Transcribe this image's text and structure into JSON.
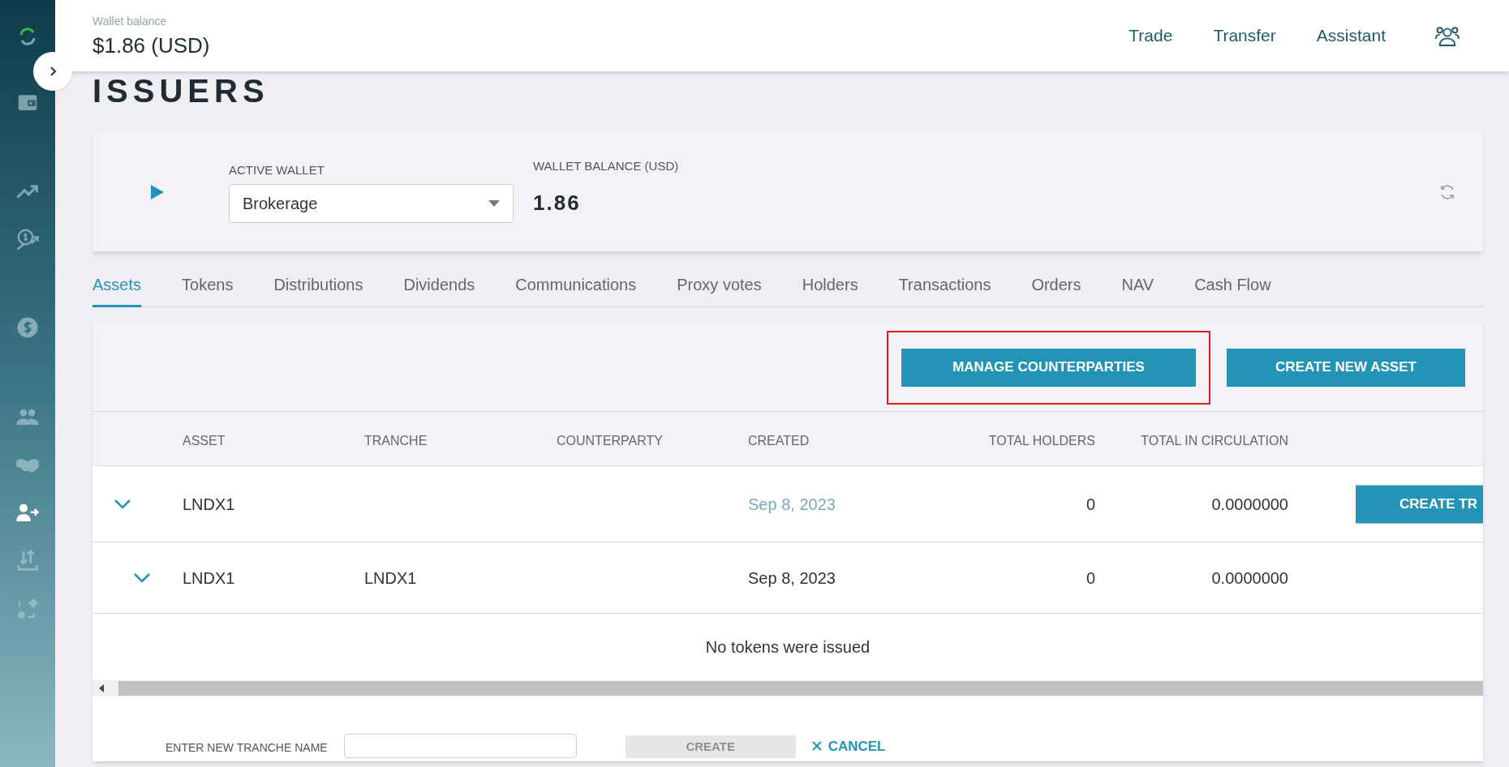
{
  "sidebar": {
    "items": [
      {
        "kind": "wallet",
        "selected": false
      },
      {
        "kind": "trend",
        "selected": false
      },
      {
        "kind": "money-trend",
        "selected": false
      },
      {
        "kind": "dollar",
        "selected": false
      },
      {
        "kind": "people",
        "selected": false
      },
      {
        "kind": "handshake",
        "selected": false
      },
      {
        "kind": "person-arrow",
        "selected": true
      },
      {
        "kind": "transfer",
        "selected": false
      },
      {
        "kind": "shapes",
        "selected": false
      }
    ]
  },
  "header": {
    "balance_label": "Wallet balance",
    "balance": "$1.86 (USD)",
    "nav": [
      "Trade",
      "Transfer",
      "Assistant"
    ]
  },
  "page_title": "ISSUERS",
  "wallet_card": {
    "active_wallet_label": "ACTIVE WALLET",
    "active_wallet": "Brokerage",
    "balance_label": "WALLET BALANCE (USD)",
    "balance": "1.86"
  },
  "tabs": [
    {
      "label": "Assets",
      "selected": true
    },
    {
      "label": "Tokens",
      "selected": false
    },
    {
      "label": "Distributions",
      "selected": false
    },
    {
      "label": "Dividends",
      "selected": false
    },
    {
      "label": "Communications",
      "selected": false
    },
    {
      "label": "Proxy votes",
      "selected": false
    },
    {
      "label": "Holders",
      "selected": false
    },
    {
      "label": "Transactions",
      "selected": false
    },
    {
      "label": "Orders",
      "selected": false
    },
    {
      "label": "NAV",
      "selected": false
    },
    {
      "label": "Cash Flow",
      "selected": false
    }
  ],
  "toolbar": {
    "buttons": [
      {
        "label": "MANAGE COUNTERPARTIES",
        "highlighted": true
      },
      {
        "label": "CREATE NEW ASSET",
        "highlighted": false
      }
    ]
  },
  "table": {
    "columns": [
      "ASSET",
      "TRANCHE",
      "COUNTERPARTY",
      "CREATED",
      "TOTAL HOLDERS",
      "TOTAL IN CIRCULATION"
    ],
    "rows": [
      {
        "kind": "asset",
        "cells": [
          "LNDX1",
          "",
          "",
          "Sep 8, 2023",
          "0",
          "0.0000000"
        ],
        "action": "CREATE TR"
      },
      {
        "kind": "tranche",
        "cells": [
          "LNDX1",
          "LNDX1",
          "",
          "Sep 8, 2023",
          "0",
          "0.0000000"
        ]
      }
    ],
    "empty_message": "No tokens were issued"
  },
  "tranche_form": {
    "label": "ENTER NEW TRANCHE NAME",
    "create": "CREATE",
    "create_disabled": true,
    "cancel": "CANCEL"
  }
}
